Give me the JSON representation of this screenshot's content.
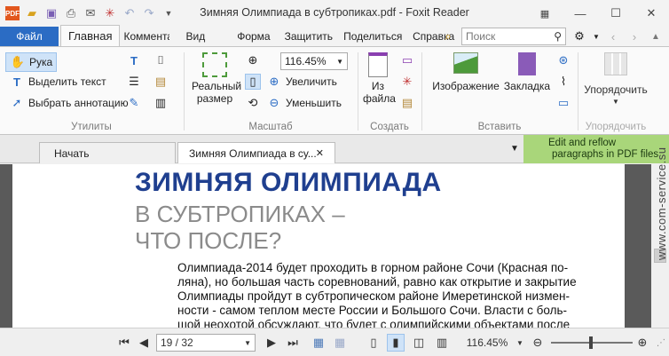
{
  "window": {
    "title": "Зимняя Олимпиада в субтропиках.pdf - Foxit Reader"
  },
  "ribbon_tabs": {
    "file": "Файл",
    "items": [
      "Главная",
      "Комментарий",
      "Вид",
      "Форма",
      "Защитить",
      "Поделиться",
      "Справка"
    ]
  },
  "search": {
    "placeholder": "Поиск"
  },
  "tools_group": {
    "label": "Утилиты",
    "hand": "Рука",
    "select_text": "Выделить текст",
    "select_annotation": "Выбрать аннотацию"
  },
  "zoom_group": {
    "label": "Масштаб",
    "actual_size": "Реальный размер",
    "zoom_value": "116.45%",
    "zoom_in": "Увеличить",
    "zoom_out": "Уменьшить"
  },
  "create_group": {
    "label": "Создать",
    "from_file": "Из файла"
  },
  "insert_group": {
    "label": "Вставить",
    "image": "Изображение",
    "bookmark": "Закладка"
  },
  "arrange_group": {
    "label": "Упорядочить",
    "arrange": "Упорядочить"
  },
  "doc_tabs": {
    "start": "Начать",
    "doc": "Зимняя Олимпиада в су..."
  },
  "promo": {
    "line1": "Edit and reflow",
    "line2": "paragraphs in PDF files"
  },
  "document": {
    "heading1": "ЗИМНЯЯ ОЛИМПИАДА",
    "heading2": "В СУБТРОПИКАХ –",
    "heading3": "ЧТО ПОСЛЕ?",
    "lines": [
      "Олимпиада-2014 будет проходить в горном районе Сочи (Красная по-",
      "ляна), но большая часть соревнований, равно как открытие и закрытие",
      "Олимпиады пройдут в субтропическом районе Имеретинской низмен-",
      "ности -  самом теплом месте России и Большого Сочи. Власти с боль-",
      "шой неохотой обсуждают, что будет с олимпийскими объектами после"
    ]
  },
  "watermark": {
    "text": "www.com-service.su"
  },
  "statusbar": {
    "page": "19 / 32",
    "zoom": "116.45%"
  },
  "colors": {
    "file_tab": "#2b6cc4",
    "heading": "#1f3f8f",
    "subheading": "#8b8b8b",
    "promo": "#a9d67a"
  }
}
